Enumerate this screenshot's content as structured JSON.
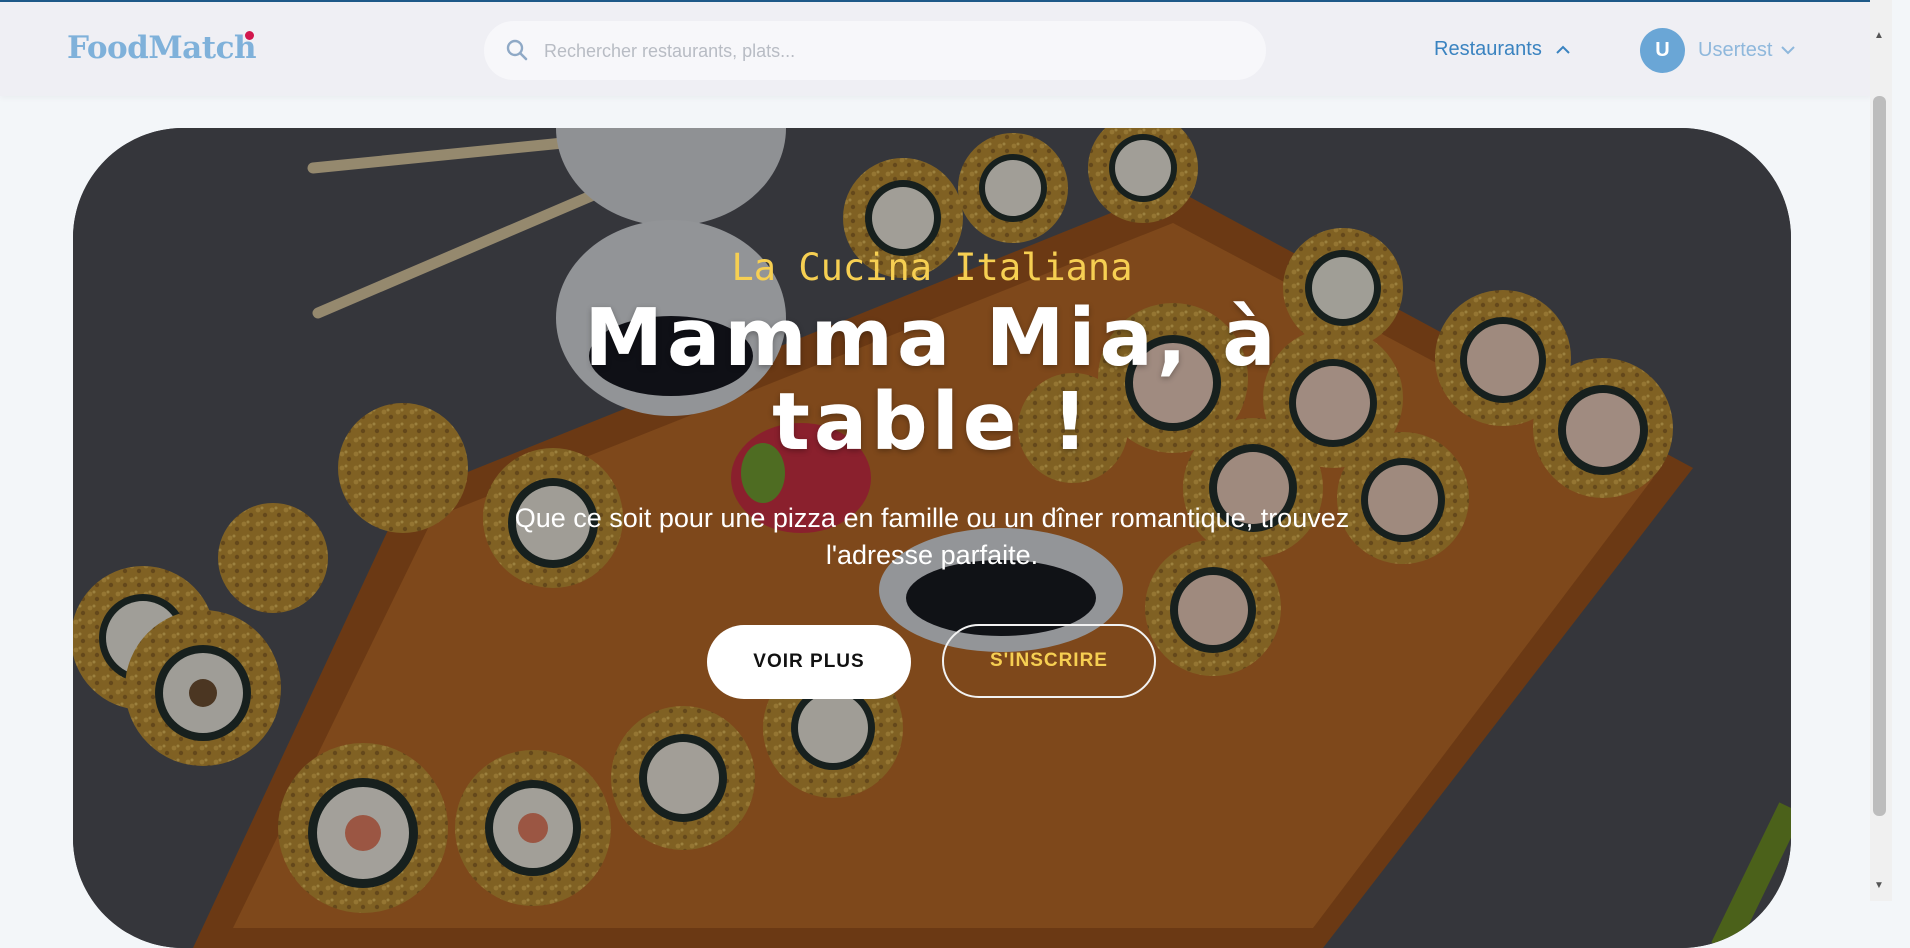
{
  "brand": {
    "name": "FoodMatch"
  },
  "search": {
    "placeholder": "Rechercher restaurants, plats..."
  },
  "nav": {
    "restaurants_label": "Restaurants"
  },
  "user": {
    "initial": "U",
    "name": "Usertest"
  },
  "hero": {
    "eyebrow": "La Cucina Italiana",
    "title": "Mamma Mia, à table !",
    "subtitle": "Que ce soit pour une pizza en famille ou un dîner romantique, trouvez l'adresse parfaite.",
    "primary_button": "VOIR PLUS",
    "secondary_button": "S'INSCRIRE"
  },
  "colors": {
    "accent": "#3a83c0",
    "brand_dot": "#d2174d",
    "highlight": "#f6cf52"
  }
}
